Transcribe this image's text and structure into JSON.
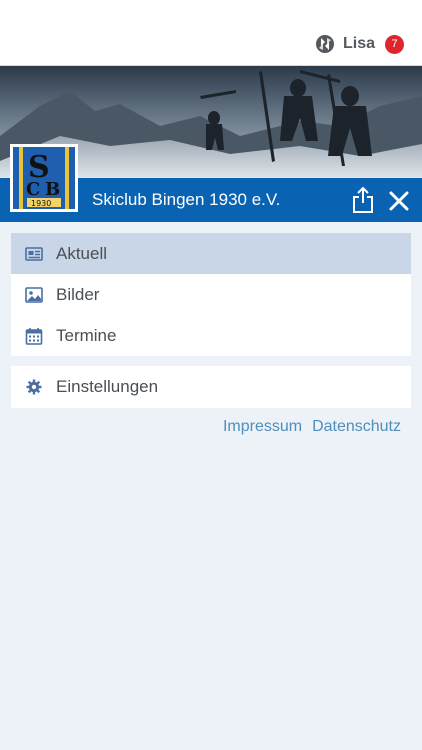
{
  "topbar": {
    "user_name": "Lisa",
    "badge_count": "7"
  },
  "header": {
    "club_name": "Skiclub Bingen 1930 e.V.",
    "logo_text": "SCB 1930"
  },
  "menu": {
    "items": [
      {
        "label": "Aktuell",
        "icon": "newspaper-icon",
        "active": true
      },
      {
        "label": "Bilder",
        "icon": "image-icon",
        "active": false
      },
      {
        "label": "Termine",
        "icon": "calendar-icon",
        "active": false
      }
    ],
    "settings_label": "Einstellungen"
  },
  "footer": {
    "impressum": "Impressum",
    "datenschutz": "Datenschutz"
  },
  "colors": {
    "brand_blue": "#0a63b2",
    "active_row": "#c8d6e7",
    "badge_red": "#e0262d",
    "link": "#4f8fb8"
  }
}
